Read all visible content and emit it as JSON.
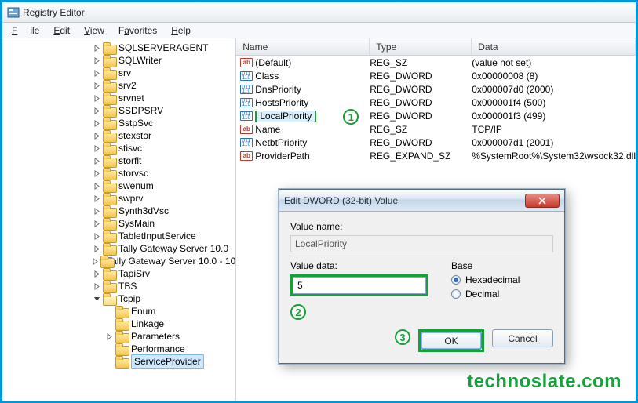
{
  "app": {
    "title": "Registry Editor"
  },
  "menu": {
    "file": "File",
    "edit": "Edit",
    "view": "View",
    "favorites": "Favorites",
    "help": "Help"
  },
  "tree": {
    "items": [
      {
        "d": 7,
        "tw": "r",
        "label": "SQLSERVERAGENT"
      },
      {
        "d": 7,
        "tw": "r",
        "label": "SQLWriter"
      },
      {
        "d": 7,
        "tw": "r",
        "label": "srv"
      },
      {
        "d": 7,
        "tw": "r",
        "label": "srv2"
      },
      {
        "d": 7,
        "tw": "r",
        "label": "srvnet"
      },
      {
        "d": 7,
        "tw": "r",
        "label": "SSDPSRV"
      },
      {
        "d": 7,
        "tw": "r",
        "label": "SstpSvc"
      },
      {
        "d": 7,
        "tw": "r",
        "label": "stexstor"
      },
      {
        "d": 7,
        "tw": "r",
        "label": "stisvc"
      },
      {
        "d": 7,
        "tw": "r",
        "label": "storflt"
      },
      {
        "d": 7,
        "tw": "r",
        "label": "storvsc"
      },
      {
        "d": 7,
        "tw": "r",
        "label": "swenum"
      },
      {
        "d": 7,
        "tw": "r",
        "label": "swprv"
      },
      {
        "d": 7,
        "tw": "r",
        "label": "Synth3dVsc"
      },
      {
        "d": 7,
        "tw": "r",
        "label": "SysMain"
      },
      {
        "d": 7,
        "tw": "r",
        "label": "TabletInputService"
      },
      {
        "d": 7,
        "tw": "r",
        "label": "Tally Gateway Server 10.0"
      },
      {
        "d": 7,
        "tw": "r",
        "label": "Tally Gateway Server 10.0 - 10"
      },
      {
        "d": 7,
        "tw": "r",
        "label": "TapiSrv"
      },
      {
        "d": 7,
        "tw": "r",
        "label": "TBS"
      },
      {
        "d": 7,
        "tw": "d",
        "label": "Tcpip",
        "open": true
      },
      {
        "d": 8,
        "tw": "",
        "label": "Enum"
      },
      {
        "d": 8,
        "tw": "",
        "label": "Linkage"
      },
      {
        "d": 8,
        "tw": "r",
        "label": "Parameters"
      },
      {
        "d": 8,
        "tw": "",
        "label": "Performance"
      },
      {
        "d": 8,
        "tw": "",
        "label": "ServiceProvider",
        "sel": true
      }
    ]
  },
  "list": {
    "cols": {
      "name": "Name",
      "type": "Type",
      "data": "Data"
    },
    "rows": [
      {
        "icon": "ab",
        "name": "(Default)",
        "type": "REG_SZ",
        "data": "(value not set)"
      },
      {
        "icon": "dw",
        "name": "Class",
        "type": "REG_DWORD",
        "data": "0x00000008 (8)"
      },
      {
        "icon": "dw",
        "name": "DnsPriority",
        "type": "REG_DWORD",
        "data": "0x000007d0 (2000)"
      },
      {
        "icon": "dw",
        "name": "HostsPriority",
        "type": "REG_DWORD",
        "data": "0x000001f4 (500)"
      },
      {
        "icon": "dw",
        "name": "LocalPriority",
        "type": "REG_DWORD",
        "data": "0x000001f3 (499)",
        "hl": true
      },
      {
        "icon": "ab",
        "name": "Name",
        "type": "REG_SZ",
        "data": "TCP/IP"
      },
      {
        "icon": "dw",
        "name": "NetbtPriority",
        "type": "REG_DWORD",
        "data": "0x000007d1 (2001)"
      },
      {
        "icon": "ab",
        "name": "ProviderPath",
        "type": "REG_EXPAND_SZ",
        "data": "%SystemRoot%\\System32\\wsock32.dll"
      }
    ]
  },
  "dlg": {
    "title": "Edit DWORD (32-bit) Value",
    "name_lbl": "Value name:",
    "name_val": "LocalPriority",
    "data_lbl": "Value data:",
    "data_val": "5",
    "base_lbl": "Base",
    "hex": "Hexadecimal",
    "dec": "Decimal",
    "ok": "OK",
    "cancel": "Cancel"
  },
  "marks": {
    "one": "1",
    "two": "2",
    "three": "3"
  },
  "watermark": "technoslate.com"
}
